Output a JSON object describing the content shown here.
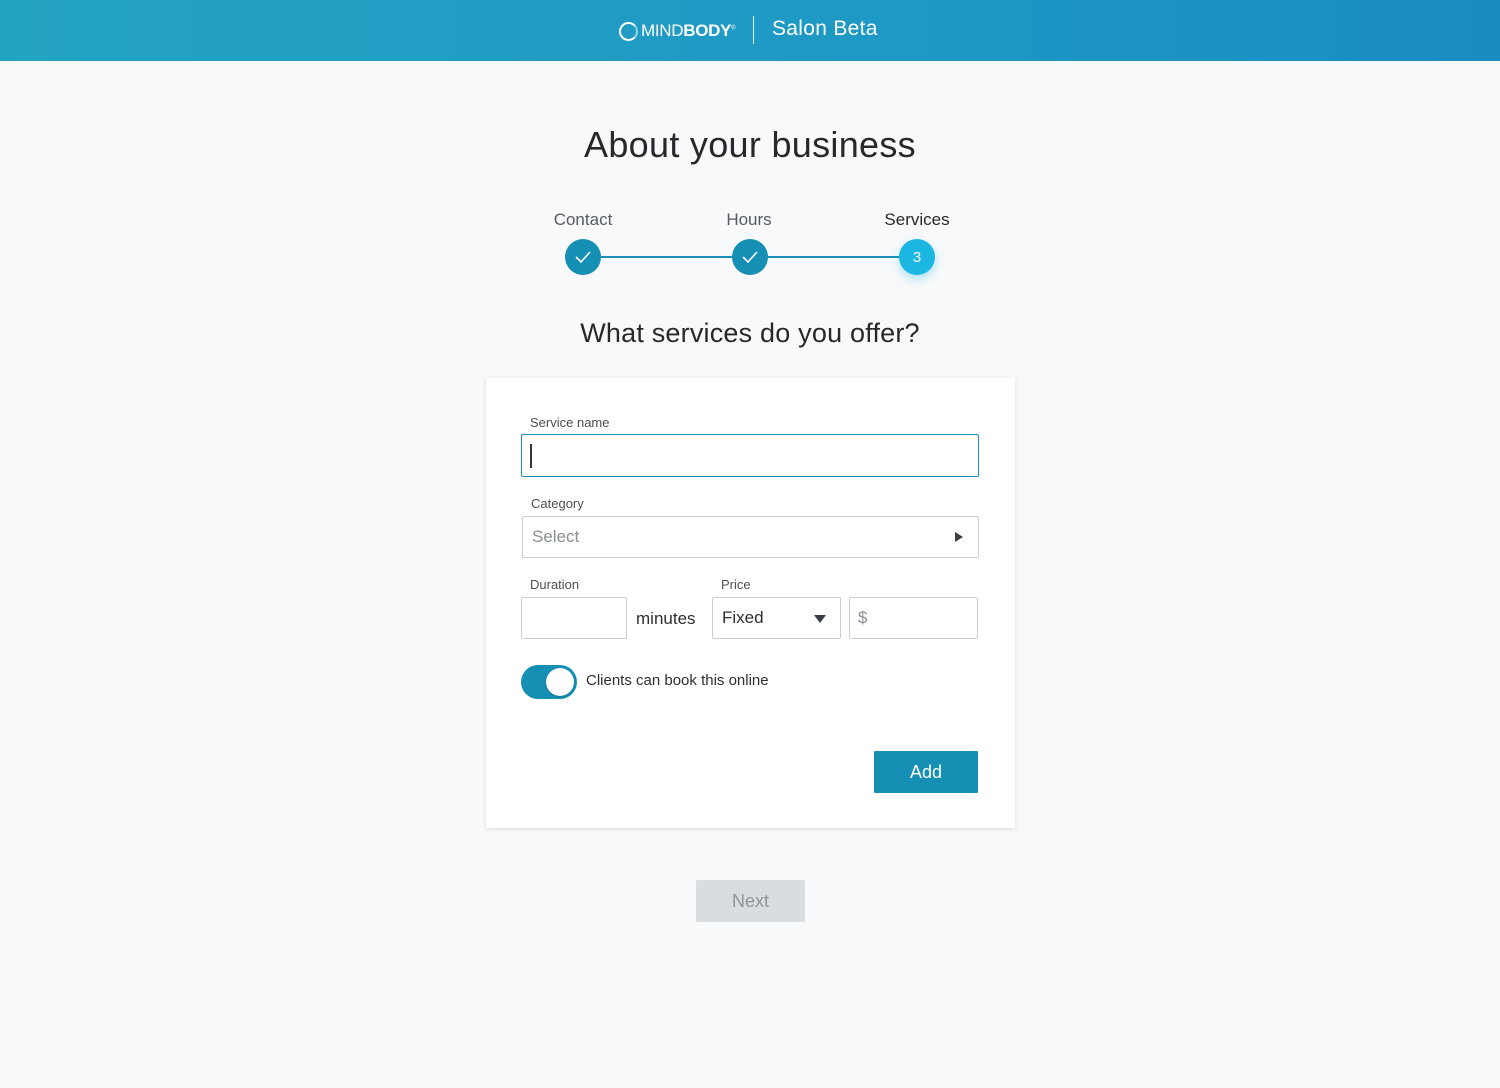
{
  "header": {
    "logo_text_light": "MIND",
    "logo_text_bold": "BODY",
    "logo_mark": "®",
    "product_name": "Salon Beta"
  },
  "page": {
    "title": "About your business",
    "section_title": "What services do you offer?"
  },
  "stepper": {
    "steps": [
      {
        "label": "Contact",
        "state": "complete",
        "icon": "check-icon"
      },
      {
        "label": "Hours",
        "state": "complete",
        "icon": "check-icon"
      },
      {
        "label": "Services",
        "state": "current",
        "number": "3"
      }
    ],
    "accent_color": "#168fb4",
    "current_color": "#1cb6e3"
  },
  "form": {
    "service_name": {
      "label": "Service name",
      "value": ""
    },
    "category": {
      "label": "Category",
      "placeholder": "Select"
    },
    "duration": {
      "label": "Duration",
      "value": "",
      "unit": "minutes"
    },
    "price": {
      "label": "Price",
      "type_value": "Fixed",
      "currency_symbol": "$",
      "amount": ""
    },
    "online_booking": {
      "label": "Clients can book this online",
      "enabled": true
    },
    "add_label": "Add"
  },
  "footer": {
    "next_label": "Next"
  }
}
